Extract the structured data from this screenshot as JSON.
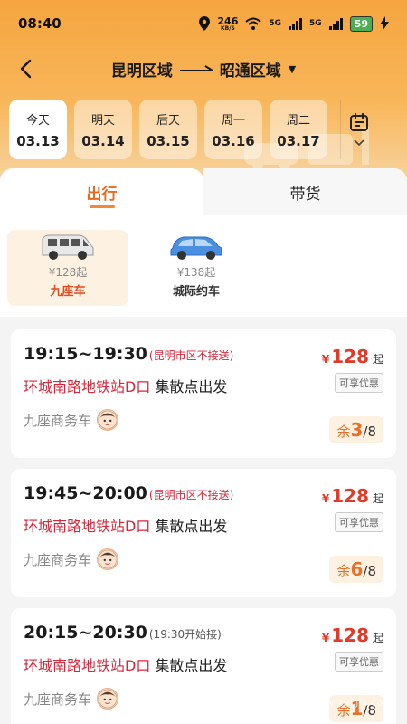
{
  "status_bar": {
    "time": "08:40",
    "net_speed": "246",
    "net_unit": "KB/S",
    "battery": "59",
    "sim1": "5G",
    "sim2": "5G"
  },
  "nav": {
    "from": "昆明区域",
    "to": "昭通区域"
  },
  "dates": [
    {
      "weekday": "今天",
      "date": "03.13",
      "active": true
    },
    {
      "weekday": "明天",
      "date": "03.14",
      "active": false
    },
    {
      "weekday": "后天",
      "date": "03.15",
      "active": false
    },
    {
      "weekday": "周一",
      "date": "03.16",
      "active": false
    },
    {
      "weekday": "周二",
      "date": "03.17",
      "active": false
    }
  ],
  "tabs": {
    "travel": "出行",
    "cargo": "带货"
  },
  "vehicle_types": [
    {
      "price": "¥128起",
      "name": "九座车",
      "active": true
    },
    {
      "price": "¥138起",
      "name": "城际约车",
      "active": false
    }
  ],
  "trips": [
    {
      "time": "19:15~19:30",
      "note": "(昆明市区不接送)",
      "note_style": "red",
      "station": "环城南路地铁站D口",
      "suffix": " 集散点出发",
      "vehicle": "九座商务车",
      "price_symbol": "¥",
      "price": "128",
      "price_unit": "起",
      "discount": "可享优惠",
      "seats_prefix": "余",
      "seats_left": "3",
      "seats_total": "/8"
    },
    {
      "time": "19:45~20:00",
      "note": "(昆明市区不接送)",
      "note_style": "red",
      "station": "环城南路地铁站D口",
      "suffix": " 集散点出发",
      "vehicle": "九座商务车",
      "price_symbol": "¥",
      "price": "128",
      "price_unit": "起",
      "discount": "可享优惠",
      "seats_prefix": "余",
      "seats_left": "6",
      "seats_total": "/8"
    },
    {
      "time": "20:15~20:30",
      "note": "(19:30开始接)",
      "note_style": "gray",
      "station": "环城南路地铁站D口",
      "suffix": " 集散点出发",
      "vehicle": "九座商务车",
      "price_symbol": "¥",
      "price": "128",
      "price_unit": "起",
      "discount": "可享优惠",
      "seats_prefix": "余",
      "seats_left": "1",
      "seats_total": "/8"
    }
  ],
  "watermark": {
    "title": "硬件之家",
    "subtitle": "YING JIAN ZHI JIA.COM"
  },
  "colors": {
    "accent": "#e96a1f",
    "price": "#e23a2a",
    "station": "#d8263a"
  }
}
